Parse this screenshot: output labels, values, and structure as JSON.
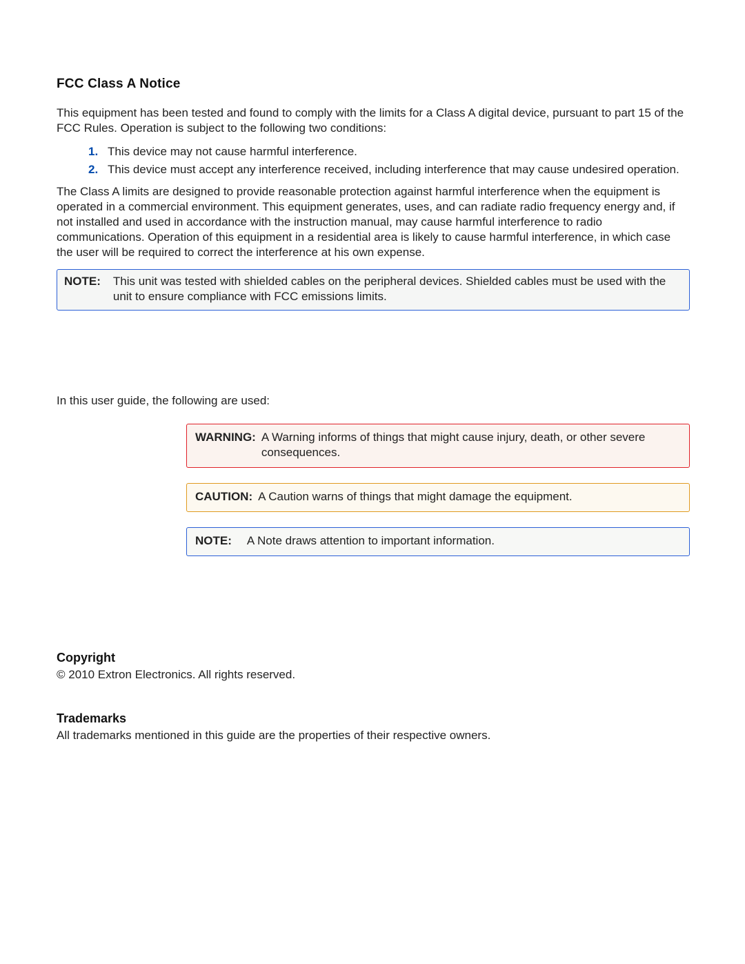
{
  "fcc": {
    "title": "FCC Class A Notice",
    "intro": "This equipment has been tested and found to comply with the limits for a Class A digital device, pursuant to part 15 of the FCC Rules. Operation is subject to the following two conditions:",
    "items": [
      "This device may not cause harmful interference.",
      "This device must accept any interference received, including interference that may cause undesired operation."
    ],
    "body": "The Class A limits are designed to provide reasonable protection against harmful interference when the equipment is operated in a commercial environment. This equipment generates, uses, and can radiate radio frequency energy and, if not installed and used in accordance with the instruction manual, may cause harmful interference to radio communications. Operation of this equipment in a residential area is likely to cause harmful interference, in which case the user will be required to correct the interference at his own expense.",
    "noteLabel": "NOTE:",
    "noteText": "This unit was tested with shielded cables on the peripheral devices. Shielded cables must be used with the unit to ensure compliance with FCC emissions limits."
  },
  "legend": {
    "intro": "In this user guide, the following are used:",
    "warning": {
      "label": "WARNING:",
      "text": "A Warning informs of things that might cause injury, death, or other severe consequences."
    },
    "caution": {
      "label": "CAUTION:",
      "text": "A Caution warns of things that might damage the equipment."
    },
    "note": {
      "label": "NOTE:",
      "text": "A Note draws attention to important information."
    }
  },
  "copyright": {
    "title": "Copyright",
    "text": "© 2010  Extron Electronics. All rights reserved."
  },
  "trademarks": {
    "title": "Trademarks",
    "text": "All trademarks mentioned in this guide are the properties of their respective owners."
  }
}
